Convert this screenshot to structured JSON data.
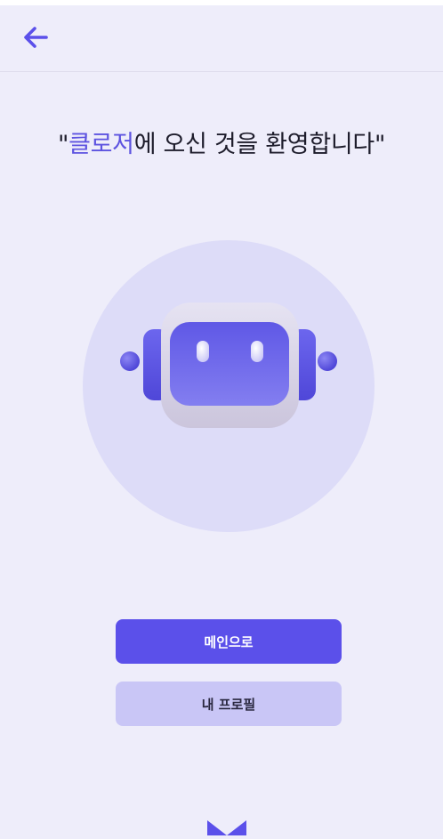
{
  "header": {
    "back_icon": "arrow-left-icon"
  },
  "welcome": {
    "quote_open": "\"",
    "brand": "클로저",
    "message": "에 오신 것을 환영합니다",
    "quote_close": "\""
  },
  "hero": {
    "illustration": "robot-icon"
  },
  "actions": {
    "main_label": "메인으로",
    "profile_label": "내 프로필"
  },
  "footer": {
    "icon": "envelope-icon"
  },
  "colors": {
    "accent": "#5b50ea",
    "background": "#eeedfa",
    "secondary_button": "#c9c6f6"
  }
}
